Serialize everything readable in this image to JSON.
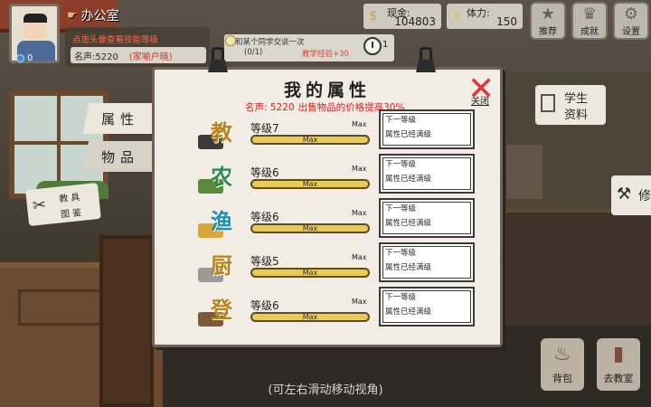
{
  "profile": {
    "location": "办公室",
    "hint": "点击头像查看技能等级",
    "fame_label": "名声:5220",
    "fame_title": "(家喻户晓)",
    "notification_count": "0"
  },
  "quest": {
    "line1": "和某个同学交谈一次",
    "progress": "(0/1)",
    "reward": "教学经验+30",
    "timer_count": "1"
  },
  "resources": {
    "gold_label": "现金:",
    "gold_value": "104803",
    "stamina_label": "体力:",
    "stamina_value": "150"
  },
  "top_buttons": {
    "recommend": "推荐",
    "achievement": "成就",
    "settings": "设置"
  },
  "side_tabs": {
    "attributes": "属性",
    "items": "物品",
    "handbook_l1": "教具",
    "handbook_l2": "图鉴"
  },
  "right_buttons": {
    "student_l1": "学生",
    "student_l2": "资料",
    "repair": "修",
    "bag": "背包",
    "classroom": "去教室"
  },
  "bottom_hint": "(可左右滑动移动视角)",
  "modal": {
    "title": "我的属性",
    "fame": "名声: 5220",
    "bonus": "出售物品的价格提高30%",
    "close": "关闭",
    "rows": [
      {
        "glyph": "教",
        "level": "等级7",
        "max": "Max",
        "bar": "Max",
        "next_title": "下一等级",
        "next_desc": "属性已经满级"
      },
      {
        "glyph": "农",
        "level": "等级6",
        "max": "Max",
        "bar": "Max",
        "next_title": "下一等级",
        "next_desc": "属性已经满级"
      },
      {
        "glyph": "渔",
        "level": "等级6",
        "max": "Max",
        "bar": "Max",
        "next_title": "下一等级",
        "next_desc": "属性已经满级"
      },
      {
        "glyph": "厨",
        "level": "等级5",
        "max": "Max",
        "bar": "Max",
        "next_title": "下一等级",
        "next_desc": "属性已经满级"
      },
      {
        "glyph": "登",
        "level": "等级6",
        "max": "Max",
        "bar": "Max",
        "next_title": "下一等级",
        "next_desc": "属性已经满级"
      }
    ]
  }
}
